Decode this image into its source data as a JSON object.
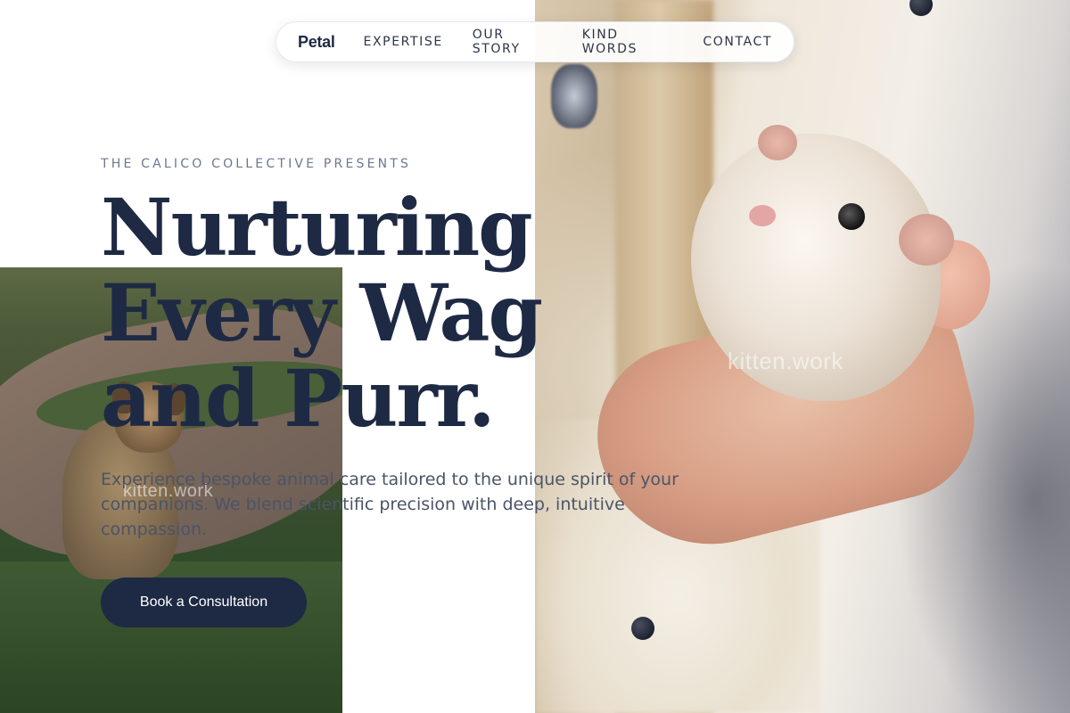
{
  "nav": {
    "brand": "Petal",
    "links": [
      {
        "label": "EXPERTISE"
      },
      {
        "label": "OUR STORY"
      },
      {
        "label": "KIND WORDS"
      },
      {
        "label": "CONTACT"
      }
    ]
  },
  "hero": {
    "eyebrow": "THE CALICO COLLECTIVE PRESENTS",
    "headline": "Nurturing Every Wag and Purr.",
    "subcopy": "Experience bespoke animal care tailored to the unique spirit of your companions. We blend scientific precision with deep, intuitive compassion.",
    "cta_label": "Book a Consultation"
  },
  "watermarks": {
    "hamster_photo": "kitten.work",
    "dog_photo": "kitten.work"
  },
  "colors": {
    "navy": "#1e2a44",
    "eyebrow": "#6b7890",
    "body_text": "#4a5468",
    "background": "#ffffff"
  }
}
